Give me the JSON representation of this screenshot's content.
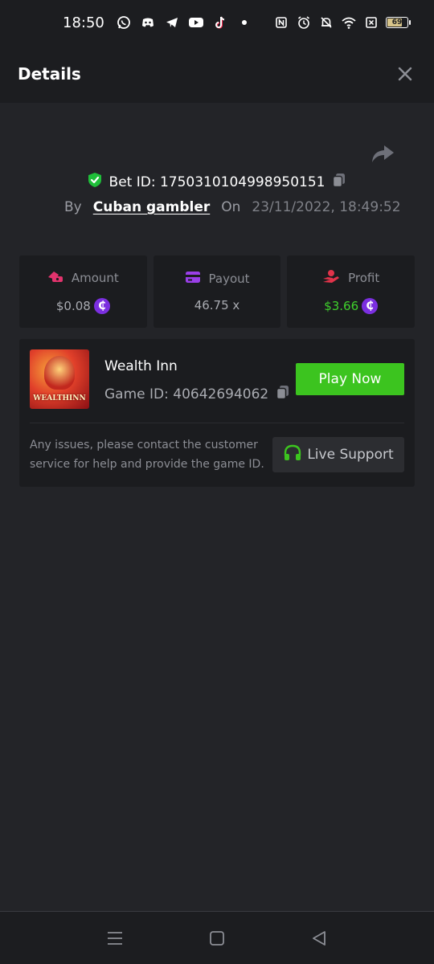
{
  "status_bar": {
    "time": "18:50",
    "notification_icons": [
      "whatsapp-icon",
      "discord-icon",
      "telegram-icon",
      "youtube-icon",
      "tiktok-icon",
      "dot-icon"
    ],
    "system_icons": [
      "nfc-icon",
      "alarm-icon",
      "mute-icon",
      "wifi-icon",
      "sim-off-icon"
    ],
    "battery_level": "69"
  },
  "header": {
    "title": "Details",
    "close_icon": "close-icon"
  },
  "bet": {
    "id_label": "Bet ID: 1750310104998950151",
    "by_label": "By",
    "username": "Cuban gambler",
    "on_label": "On",
    "datetime": "23/11/2022, 18:49:52"
  },
  "stats": {
    "amount": {
      "label": "Amount",
      "value": "$0.08"
    },
    "payout": {
      "label": "Payout",
      "value": "46.75 x"
    },
    "profit": {
      "label": "Profit",
      "value": "$3.66"
    }
  },
  "game": {
    "name": "Wealth Inn",
    "id_label": "Game ID: 40642694062",
    "thumb_text": "WEALTHINN",
    "play_label": "Play Now",
    "support_text": "Any issues, please contact the customer service for help and provide the game ID.",
    "support_label": "Live Support"
  },
  "colors": {
    "background": "#232428",
    "card": "#1b1c1f",
    "accent_green": "#3cc41f",
    "profit_green": "#3fd12c",
    "coin_purple": "#7b2fe0",
    "shield_green": "#1fbf3a"
  }
}
